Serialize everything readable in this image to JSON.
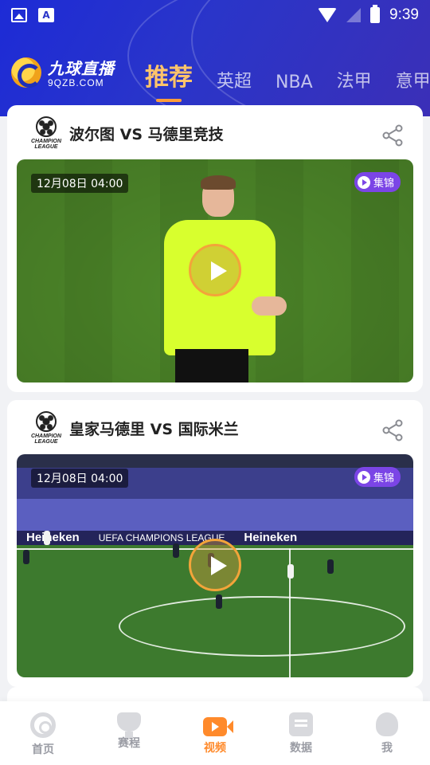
{
  "status_bar": {
    "time": "9:39",
    "icons": [
      "gallery-icon",
      "a-icon",
      "wifi-icon",
      "no-signal-icon",
      "battery-charging-icon"
    ]
  },
  "app": {
    "logo_cn": "九球直播",
    "logo_en": "9QZB.COM"
  },
  "tabs": [
    {
      "label": "推荐",
      "active": true
    },
    {
      "label": "英超",
      "active": false
    },
    {
      "label": "NBA",
      "active": false
    },
    {
      "label": "法甲",
      "active": false
    },
    {
      "label": "意甲",
      "active": false
    }
  ],
  "cards": [
    {
      "title": "波尔图 VS 马德里竞技",
      "date": "12月08日 04:00",
      "tag": "集锦",
      "league_logo_text": "CHAMPIONS LEAGUE"
    },
    {
      "title": "皇家马德里 VS 国际米兰",
      "date": "12月08日 04:00",
      "tag": "集锦",
      "league_logo_text": "CHAMPIONS LEAGUE"
    }
  ],
  "bottom_nav": [
    {
      "label": "首页",
      "icon": "home-icon",
      "active": false
    },
    {
      "label": "赛程",
      "icon": "trophy-icon",
      "active": false
    },
    {
      "label": "视频",
      "icon": "video-icon",
      "active": true
    },
    {
      "label": "数据",
      "icon": "data-icon",
      "active": false
    },
    {
      "label": "我",
      "icon": "profile-icon",
      "active": false
    }
  ],
  "colors": {
    "header": "#2a35c9",
    "accent": "#ff8a2b",
    "active_tab": "#ffc46b",
    "tag": "#7b45e6"
  }
}
